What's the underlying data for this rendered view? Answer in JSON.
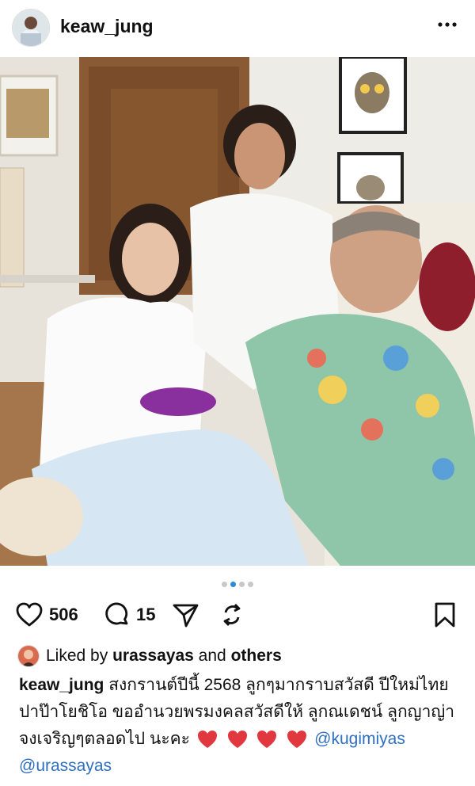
{
  "post": {
    "username": "keaw_jung",
    "likes": "506",
    "comments": "15",
    "carousel": {
      "count": 4,
      "active_index": 1
    },
    "liked_by": {
      "prefix": "Liked by",
      "user": "urassayas",
      "connector": "and",
      "others": "others"
    },
    "caption": {
      "username": "keaw_jung",
      "text": " สงกรานต์ปีนี้ 2568 ลูกๆมากราบสวัสดี ปีใหม่ไทย ปาป๊าโยชิโอ ขออำนวยพรมงคลสวัสดีให้ ลูกณเดชน์ ลูกญาญ่า จงเจริญๆตลอดไป นะคะ ",
      "mentions": [
        "@kugimiyas",
        "@urassayas"
      ]
    }
  },
  "icons": [
    "heart-icon",
    "comment-icon",
    "share-icon",
    "repost-icon",
    "bookmark-icon",
    "more-icon"
  ],
  "colors": {
    "mention": "#2f6fbf",
    "dot_active": "#2a8bd8",
    "heart_emoji": "#e0383e"
  }
}
